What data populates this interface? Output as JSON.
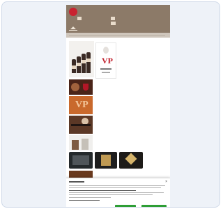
{
  "header": {
    "brand_line1": "",
    "brand_line2": ""
  },
  "cookie": {
    "close_glyph": "×"
  },
  "colors": {
    "header_bg": "#8c7a68",
    "nav_bg": "#cfc6bc",
    "logo_red": "#c9232f",
    "wine_red": "#b31727",
    "button_green": "#2e9e35"
  },
  "icons": [
    "logo-icon",
    "phone-icon",
    "mail-icon",
    "home-icon",
    "close-icon"
  ]
}
